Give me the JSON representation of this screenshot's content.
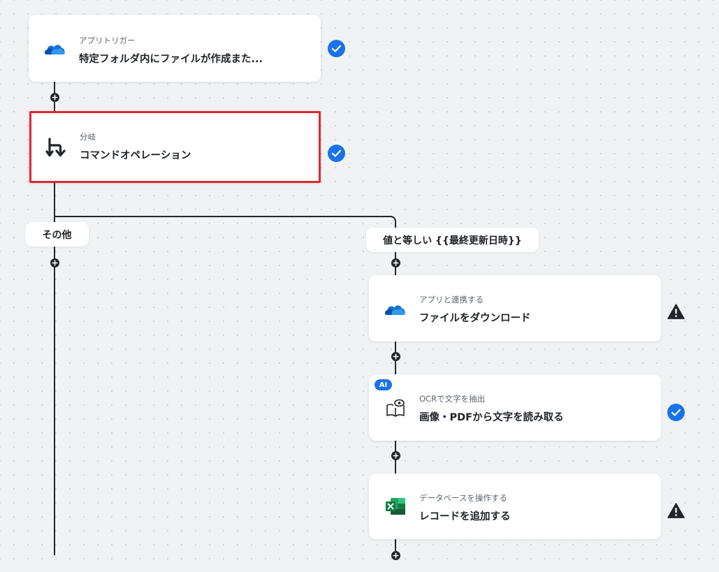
{
  "flow": {
    "trigger": {
      "subtitle": "アプリトリガー",
      "title": "特定フォルダ内にファイルが作成また...",
      "icon": "onedrive-icon",
      "status": "check"
    },
    "branch": {
      "subtitle": "分岐",
      "title": "コマンドオペレーション",
      "icon": "branch-icon",
      "status": "check"
    },
    "branch_labels": {
      "other": "その他",
      "equals": "値と等しい {{最終更新日時}}"
    },
    "steps": [
      {
        "subtitle": "アプリと連携する",
        "title": "ファイルをダウンロード",
        "icon": "onedrive-icon",
        "status": "warning"
      },
      {
        "subtitle": "OCRで文字を抽出",
        "title": "画像・PDFから文字を読み取る",
        "icon": "ocr-book-icon",
        "status": "check",
        "badge": "AI"
      },
      {
        "subtitle": "データベースを操作する",
        "title": "レコードを追加する",
        "icon": "excel-icon",
        "status": "warning"
      }
    ]
  },
  "colors": {
    "accent": "#1a73e8",
    "selected_border": "#e0282d",
    "connector": "#22252b"
  }
}
